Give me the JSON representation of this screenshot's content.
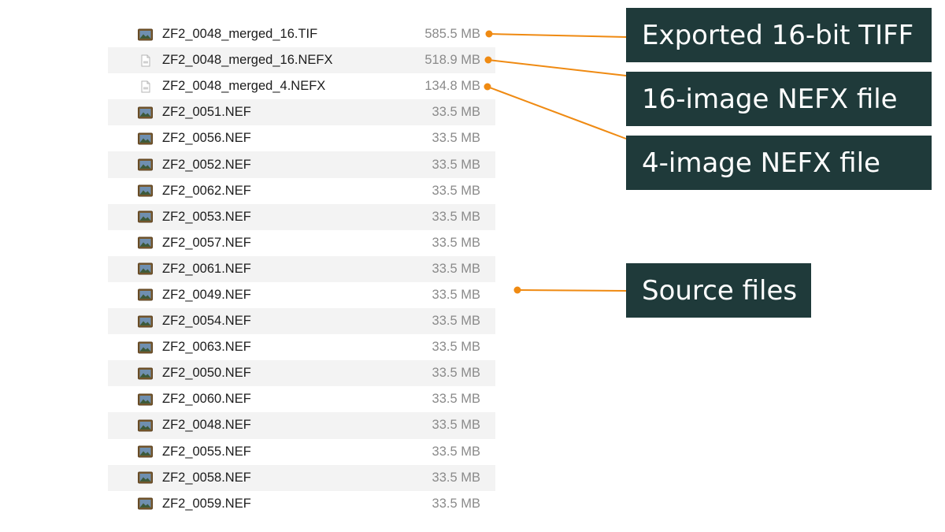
{
  "files": [
    {
      "name": "ZF2_0048_merged_16.TIF",
      "size": "585.5 MB",
      "icon": "image-file-icon"
    },
    {
      "name": "ZF2_0048_merged_16.NEFX",
      "size": "518.9 MB",
      "icon": "document-file-icon"
    },
    {
      "name": "ZF2_0048_merged_4.NEFX",
      "size": "134.8 MB",
      "icon": "document-file-icon"
    },
    {
      "name": "ZF2_0051.NEF",
      "size": "33.5 MB",
      "icon": "image-file-icon"
    },
    {
      "name": "ZF2_0056.NEF",
      "size": "33.5 MB",
      "icon": "image-file-icon"
    },
    {
      "name": "ZF2_0052.NEF",
      "size": "33.5 MB",
      "icon": "image-file-icon"
    },
    {
      "name": "ZF2_0062.NEF",
      "size": "33.5 MB",
      "icon": "image-file-icon"
    },
    {
      "name": "ZF2_0053.NEF",
      "size": "33.5 MB",
      "icon": "image-file-icon"
    },
    {
      "name": "ZF2_0057.NEF",
      "size": "33.5 MB",
      "icon": "image-file-icon"
    },
    {
      "name": "ZF2_0061.NEF",
      "size": "33.5 MB",
      "icon": "image-file-icon"
    },
    {
      "name": "ZF2_0049.NEF",
      "size": "33.5 MB",
      "icon": "image-file-icon"
    },
    {
      "name": "ZF2_0054.NEF",
      "size": "33.5 MB",
      "icon": "image-file-icon"
    },
    {
      "name": "ZF2_0063.NEF",
      "size": "33.5 MB",
      "icon": "image-file-icon"
    },
    {
      "name": "ZF2_0050.NEF",
      "size": "33.5 MB",
      "icon": "image-file-icon"
    },
    {
      "name": "ZF2_0060.NEF",
      "size": "33.5 MB",
      "icon": "image-file-icon"
    },
    {
      "name": "ZF2_0048.NEF",
      "size": "33.5 MB",
      "icon": "image-file-icon"
    },
    {
      "name": "ZF2_0055.NEF",
      "size": "33.5 MB",
      "icon": "image-file-icon"
    },
    {
      "name": "ZF2_0058.NEF",
      "size": "33.5 MB",
      "icon": "image-file-icon"
    },
    {
      "name": "ZF2_0059.NEF",
      "size": "33.5 MB",
      "icon": "image-file-icon"
    }
  ],
  "callouts": {
    "tiff": "Exported 16-bit TIFF",
    "nefx16": "16-image NEFX file",
    "nefx4": "4-image NEFX file",
    "source": "Source files"
  },
  "colors": {
    "callout_bg": "#1f3a3a",
    "callout_text": "#ffffff",
    "leader_line": "#ef8a12",
    "row_alt": "#f3f3f3",
    "size_text": "#8a8a8a"
  }
}
